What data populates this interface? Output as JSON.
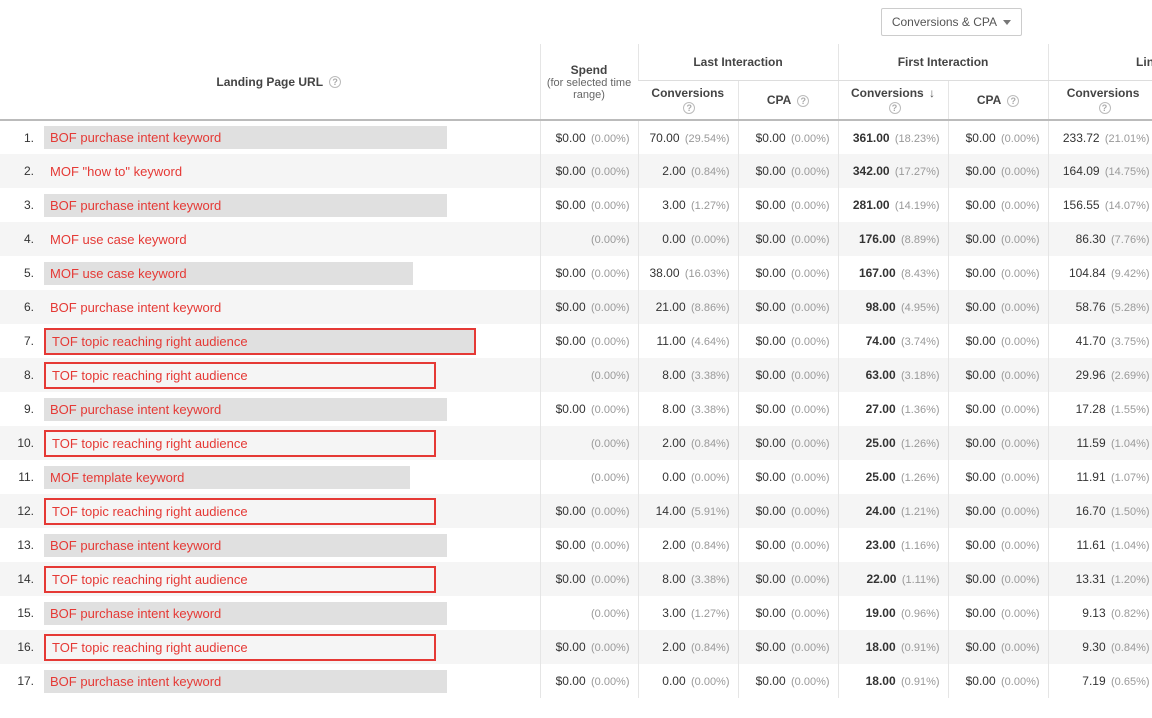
{
  "dropdown": {
    "label": "Conversions & CPA"
  },
  "headers": {
    "landing_page": "Landing Page URL",
    "spend": "Spend",
    "spend_sub": "(for selected time range)",
    "last_interaction": "Last Interaction",
    "first_interaction": "First Interaction",
    "linear": "Linear",
    "conversions": "Conversions",
    "cpa": "CPA"
  },
  "rows": [
    {
      "idx": "1.",
      "label": "BOF purchase intent keyword",
      "boxed": false,
      "spend": "$0.00",
      "spend_pct": "(0.00%)",
      "li_conv": "70.00",
      "li_conv_pct": "(29.54%)",
      "li_cpa": "$0.00",
      "li_cpa_pct": "(0.00%)",
      "fi_conv": "361.00",
      "fi_conv_pct": "(18.23%)",
      "fi_cpa": "$0.00",
      "fi_cpa_pct": "(0.00%)",
      "ln_conv": "233.72",
      "ln_conv_pct": "(21.01%)",
      "tail": "$"
    },
    {
      "idx": "2.",
      "label": "MOF \"how to\" keyword",
      "boxed": false,
      "spend": "$0.00",
      "spend_pct": "(0.00%)",
      "li_conv": "2.00",
      "li_conv_pct": "(0.84%)",
      "li_cpa": "$0.00",
      "li_cpa_pct": "(0.00%)",
      "fi_conv": "342.00",
      "fi_conv_pct": "(17.27%)",
      "fi_cpa": "$0.00",
      "fi_cpa_pct": "(0.00%)",
      "ln_conv": "164.09",
      "ln_conv_pct": "(14.75%)",
      "tail": "$"
    },
    {
      "idx": "3.",
      "label": "BOF purchase intent keyword",
      "boxed": false,
      "spend": "$0.00",
      "spend_pct": "(0.00%)",
      "li_conv": "3.00",
      "li_conv_pct": "(1.27%)",
      "li_cpa": "$0.00",
      "li_cpa_pct": "(0.00%)",
      "fi_conv": "281.00",
      "fi_conv_pct": "(14.19%)",
      "fi_cpa": "$0.00",
      "fi_cpa_pct": "(0.00%)",
      "ln_conv": "156.55",
      "ln_conv_pct": "(14.07%)",
      "tail": "$"
    },
    {
      "idx": "4.",
      "label": "MOF use case keyword",
      "boxed": false,
      "spend": "",
      "spend_pct": "(0.00%)",
      "li_conv": "0.00",
      "li_conv_pct": "(0.00%)",
      "li_cpa": "$0.00",
      "li_cpa_pct": "(0.00%)",
      "fi_conv": "176.00",
      "fi_conv_pct": "(8.89%)",
      "fi_cpa": "$0.00",
      "fi_cpa_pct": "(0.00%)",
      "ln_conv": "86.30",
      "ln_conv_pct": "(7.76%)",
      "tail": "$"
    },
    {
      "idx": "5.",
      "label": "MOF use case keyword",
      "boxed": false,
      "spend": "$0.00",
      "spend_pct": "(0.00%)",
      "li_conv": "38.00",
      "li_conv_pct": "(16.03%)",
      "li_cpa": "$0.00",
      "li_cpa_pct": "(0.00%)",
      "fi_conv": "167.00",
      "fi_conv_pct": "(8.43%)",
      "fi_cpa": "$0.00",
      "fi_cpa_pct": "(0.00%)",
      "ln_conv": "104.84",
      "ln_conv_pct": "(9.42%)",
      "tail": "$"
    },
    {
      "idx": "6.",
      "label": "BOF purchase intent keyword",
      "boxed": false,
      "spend": "$0.00",
      "spend_pct": "(0.00%)",
      "li_conv": "21.00",
      "li_conv_pct": "(8.86%)",
      "li_cpa": "$0.00",
      "li_cpa_pct": "(0.00%)",
      "fi_conv": "98.00",
      "fi_conv_pct": "(4.95%)",
      "fi_cpa": "$0.00",
      "fi_cpa_pct": "(0.00%)",
      "ln_conv": "58.76",
      "ln_conv_pct": "(5.28%)",
      "tail": "$"
    },
    {
      "idx": "7.",
      "label": "TOF topic reaching right audience",
      "boxed": true,
      "spend": "$0.00",
      "spend_pct": "(0.00%)",
      "li_conv": "11.00",
      "li_conv_pct": "(4.64%)",
      "li_cpa": "$0.00",
      "li_cpa_pct": "(0.00%)",
      "fi_conv": "74.00",
      "fi_conv_pct": "(3.74%)",
      "fi_cpa": "$0.00",
      "fi_cpa_pct": "(0.00%)",
      "ln_conv": "41.70",
      "ln_conv_pct": "(3.75%)",
      "tail": "$"
    },
    {
      "idx": "8.",
      "label": "TOF topic reaching right audience",
      "boxed": true,
      "spend": "",
      "spend_pct": "(0.00%)",
      "li_conv": "8.00",
      "li_conv_pct": "(3.38%)",
      "li_cpa": "$0.00",
      "li_cpa_pct": "(0.00%)",
      "fi_conv": "63.00",
      "fi_conv_pct": "(3.18%)",
      "fi_cpa": "$0.00",
      "fi_cpa_pct": "(0.00%)",
      "ln_conv": "29.96",
      "ln_conv_pct": "(2.69%)",
      "tail": "$"
    },
    {
      "idx": "9.",
      "label": "BOF purchase intent keyword",
      "boxed": false,
      "spend": "$0.00",
      "spend_pct": "(0.00%)",
      "li_conv": "8.00",
      "li_conv_pct": "(3.38%)",
      "li_cpa": "$0.00",
      "li_cpa_pct": "(0.00%)",
      "fi_conv": "27.00",
      "fi_conv_pct": "(1.36%)",
      "fi_cpa": "$0.00",
      "fi_cpa_pct": "(0.00%)",
      "ln_conv": "17.28",
      "ln_conv_pct": "(1.55%)",
      "tail": "$"
    },
    {
      "idx": "10.",
      "label": "TOF topic reaching right audience",
      "boxed": true,
      "spend": "",
      "spend_pct": "(0.00%)",
      "li_conv": "2.00",
      "li_conv_pct": "(0.84%)",
      "li_cpa": "$0.00",
      "li_cpa_pct": "(0.00%)",
      "fi_conv": "25.00",
      "fi_conv_pct": "(1.26%)",
      "fi_cpa": "$0.00",
      "fi_cpa_pct": "(0.00%)",
      "ln_conv": "11.59",
      "ln_conv_pct": "(1.04%)",
      "tail": "$"
    },
    {
      "idx": "11.",
      "label": "MOF template keyword",
      "boxed": false,
      "spend": "",
      "spend_pct": "(0.00%)",
      "li_conv": "0.00",
      "li_conv_pct": "(0.00%)",
      "li_cpa": "$0.00",
      "li_cpa_pct": "(0.00%)",
      "fi_conv": "25.00",
      "fi_conv_pct": "(1.26%)",
      "fi_cpa": "$0.00",
      "fi_cpa_pct": "(0.00%)",
      "ln_conv": "11.91",
      "ln_conv_pct": "(1.07%)",
      "tail": "$"
    },
    {
      "idx": "12.",
      "label": "TOF topic reaching right audience",
      "boxed": true,
      "spend": "$0.00",
      "spend_pct": "(0.00%)",
      "li_conv": "14.00",
      "li_conv_pct": "(5.91%)",
      "li_cpa": "$0.00",
      "li_cpa_pct": "(0.00%)",
      "fi_conv": "24.00",
      "fi_conv_pct": "(1.21%)",
      "fi_cpa": "$0.00",
      "fi_cpa_pct": "(0.00%)",
      "ln_conv": "16.70",
      "ln_conv_pct": "(1.50%)",
      "tail": "$"
    },
    {
      "idx": "13.",
      "label": "BOF purchase intent keyword",
      "boxed": false,
      "spend": "$0.00",
      "spend_pct": "(0.00%)",
      "li_conv": "2.00",
      "li_conv_pct": "(0.84%)",
      "li_cpa": "$0.00",
      "li_cpa_pct": "(0.00%)",
      "fi_conv": "23.00",
      "fi_conv_pct": "(1.16%)",
      "fi_cpa": "$0.00",
      "fi_cpa_pct": "(0.00%)",
      "ln_conv": "11.61",
      "ln_conv_pct": "(1.04%)",
      "tail": "$"
    },
    {
      "idx": "14.",
      "label": "TOF topic reaching right audience",
      "boxed": true,
      "spend": "$0.00",
      "spend_pct": "(0.00%)",
      "li_conv": "8.00",
      "li_conv_pct": "(3.38%)",
      "li_cpa": "$0.00",
      "li_cpa_pct": "(0.00%)",
      "fi_conv": "22.00",
      "fi_conv_pct": "(1.11%)",
      "fi_cpa": "$0.00",
      "fi_cpa_pct": "(0.00%)",
      "ln_conv": "13.31",
      "ln_conv_pct": "(1.20%)",
      "tail": "$"
    },
    {
      "idx": "15.",
      "label": "BOF purchase intent keyword",
      "boxed": false,
      "spend": "",
      "spend_pct": "(0.00%)",
      "li_conv": "3.00",
      "li_conv_pct": "(1.27%)",
      "li_cpa": "$0.00",
      "li_cpa_pct": "(0.00%)",
      "fi_conv": "19.00",
      "fi_conv_pct": "(0.96%)",
      "fi_cpa": "$0.00",
      "fi_cpa_pct": "(0.00%)",
      "ln_conv": "9.13",
      "ln_conv_pct": "(0.82%)",
      "tail": "$"
    },
    {
      "idx": "16.",
      "label": "TOF topic reaching right audience",
      "boxed": true,
      "spend": "$0.00",
      "spend_pct": "(0.00%)",
      "li_conv": "2.00",
      "li_conv_pct": "(0.84%)",
      "li_cpa": "$0.00",
      "li_cpa_pct": "(0.00%)",
      "fi_conv": "18.00",
      "fi_conv_pct": "(0.91%)",
      "fi_cpa": "$0.00",
      "fi_cpa_pct": "(0.00%)",
      "ln_conv": "9.30",
      "ln_conv_pct": "(0.84%)",
      "tail": "$"
    },
    {
      "idx": "17.",
      "label": "BOF purchase intent keyword",
      "boxed": false,
      "spend": "$0.00",
      "spend_pct": "(0.00%)",
      "li_conv": "0.00",
      "li_conv_pct": "(0.00%)",
      "li_cpa": "$0.00",
      "li_cpa_pct": "(0.00%)",
      "fi_conv": "18.00",
      "fi_conv_pct": "(0.91%)",
      "fi_cpa": "$0.00",
      "fi_cpa_pct": "(0.00%)",
      "ln_conv": "7.19",
      "ln_conv_pct": "(0.65%)",
      "tail": "$"
    }
  ]
}
